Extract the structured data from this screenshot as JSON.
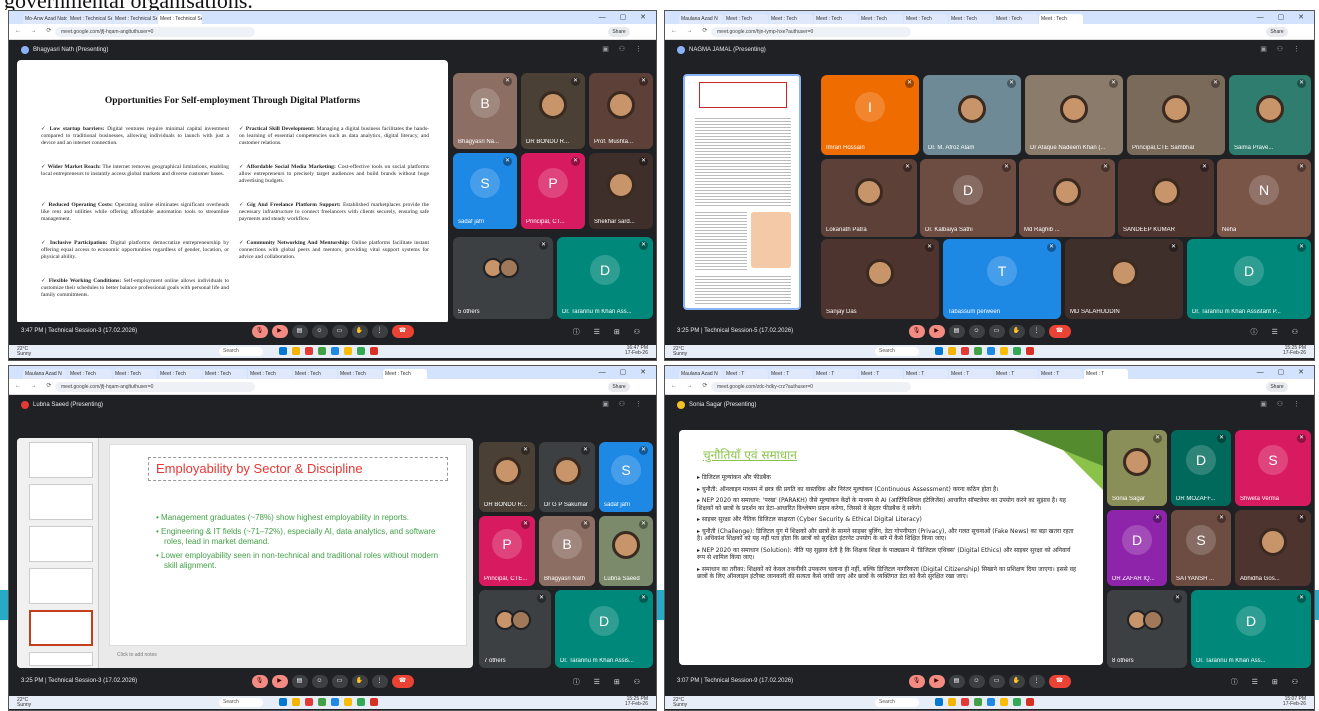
{
  "caption_fragment": "governmental organisations.",
  "tabs": {
    "q1": [
      "Mo-Anw Azad Natonal Urdu U",
      "Meet : Technical Session 3",
      "Meet : Technical Session 3",
      "Meet : Technical Session 3"
    ],
    "q2": [
      "Maulana Azad N",
      "Meet : Tech",
      "Meet : Tech",
      "Meet : Tech",
      "Meet : Tech",
      "Meet : Tech",
      "Meet : Tech",
      "Meet : Tech",
      "Meet : Tech"
    ],
    "q3": [
      "Maulana Azad N",
      "Meet : Tech",
      "Meet : Tech",
      "Meet : Tech",
      "Meet : Tech",
      "Meet : Tech",
      "Meet : Tech",
      "Meet : Tech",
      "Meet : Tech"
    ],
    "q4": [
      "Maulana Azad N",
      "Meet : T",
      "Meet : T",
      "Meet : T",
      "Meet : T",
      "Meet : T",
      "Meet : T",
      "Meet : T",
      "Meet : T",
      "Meet : T"
    ]
  },
  "urls": {
    "q1": "meet.google.com/jfj-hqam-angltuthuser=0",
    "q2": "meet.google.com/hjn-iymp-hxe?authuser=0",
    "q3": "meet.google.com/jfj-hqam-angltuthuser=0",
    "q4": "meet.google.com/zdc-hdky-crz?authuser=0"
  },
  "profile_label": "Share",
  "window_controls": "— ▢ ✕",
  "presenters": {
    "q1": "Bhagyasri Nath (Presenting)",
    "q2": "NAGMA JAMAL (Presenting)",
    "q3": "Lubna Saeed (Presenting)",
    "q4": "Sonia Sagar (Presenting)"
  },
  "meeting_info": {
    "q1": "3:47 PM  |  Technical Session-3 (17.02.2026)",
    "q2": "3:25 PM  |  Technical Session-5 (17.02.2026)",
    "q3": "3:25 PM  |  Technical Session-3 (17.02.2026)",
    "q4": "3:07 PM  |  Technical Session-9 (17.02.2026)"
  },
  "slide1": {
    "title": "Opportunities For Self-employment Through Digital Platforms",
    "left": [
      {
        "head": "Low startup barriers:",
        "text": "Digital ventures require minimal capital investment compared to traditional businesses, allowing individuals to launch with just a device and an internet connection."
      },
      {
        "head": "Wider Market Reach:",
        "text": "The internet removes geographical limitations, enabling local entrepreneurs to instantly access global markets and diverse customer bases."
      },
      {
        "head": "Reduced Operating Costs:",
        "text": "Operating online eliminates significant overheads like rent and utilities while offering affordable automation tools to streamline management."
      },
      {
        "head": "Inclusive Participation:",
        "text": "Digital platforms democratize entrepreneurship by offering equal access to economic opportunities regardless of gender, location, or physical ability."
      },
      {
        "head": "Flexible Working Conditions:",
        "text": "Self-employment online allows individuals to customize their schedules to better balance professional goals with personal life and family commitments."
      }
    ],
    "right": [
      {
        "head": "Practical Skill Development:",
        "text": "Managing a digital business facilitates the hands-on learning of essential competencies such as data analytics, digital literacy, and customer relations."
      },
      {
        "head": "Affordable Social Media Marketing:",
        "text": "Cost-effective tools on social platforms allow entrepreneurs to precisely target audiences and build brands without huge advertising budgets."
      },
      {
        "head": "Gig And Freelance Platform Support:",
        "text": "Established marketplaces provide the necessary infrastructure to connect freelancers with clients securely, ensuring safe payments and steady workflow."
      },
      {
        "head": "Community Networking And Mentorship:",
        "text": "Online platforms facilitate instant connections with global peers and mentors, providing vital support systems for advice and collaboration."
      }
    ]
  },
  "tiles_q1": [
    {
      "name": "Bhagyasri Na...",
      "initial": "B",
      "color": "#8d6e63"
    },
    {
      "name": "DR BONDU R...",
      "initial": "",
      "color": "#4a4036"
    },
    {
      "name": "Prof. Mushta...",
      "initial": "",
      "color": "#5d4037"
    },
    {
      "name": "sadaf jafri",
      "initial": "S",
      "color": "#1e88e5"
    },
    {
      "name": "Principal, CT...",
      "initial": "P",
      "color": "#d81b60"
    },
    {
      "name": "Shekhar sard...",
      "initial": "",
      "color": "#3e2f2a"
    },
    {
      "name": "5 others",
      "initial": "",
      "color": "#3c4043"
    },
    {
      "name": "Dr. Tarannu m Khan Ass...",
      "initial": "D",
      "color": "#00897b"
    }
  ],
  "tiles_q2": [
    {
      "name": "Imran Hossain",
      "initial": "I",
      "color": "#ef6c00"
    },
    {
      "name": "Dr. M. Afroz Alam",
      "initial": "",
      "color": "#6d8a96"
    },
    {
      "name": "Dr Afaque Nadeem Khan (...",
      "initial": "",
      "color": "#8a7b6a"
    },
    {
      "name": "Principal,CTE Sambhal",
      "initial": "",
      "color": "#7a6a5a"
    },
    {
      "name": "Saima Prave...",
      "initial": "",
      "color": "#2e7d6e"
    },
    {
      "name": "Lokanath Patra",
      "initial": "",
      "color": "#5d4037"
    },
    {
      "name": "Dr. Kalbaiya Sathi",
      "initial": "D",
      "color": "#6d4c41"
    },
    {
      "name": "Md Raghib ...",
      "initial": "",
      "color": "#6d4c41"
    },
    {
      "name": "SANDEEP KUMAR",
      "initial": "",
      "color": "#4e342e"
    },
    {
      "name": "Neha",
      "initial": "N",
      "color": "#795548"
    },
    {
      "name": "Sanjay Das",
      "initial": "",
      "color": "#4e342e"
    },
    {
      "name": "Tabassum perween",
      "initial": "T",
      "color": "#1e88e5"
    },
    {
      "name": "MD SALAHUDDIN",
      "initial": "",
      "color": "#3e2f2a"
    },
    {
      "name": "Dr. Tarannu m Khan Assistant P...",
      "initial": "D",
      "color": "#00897b"
    }
  ],
  "slide3": {
    "title": "Employability by Sector & Discipline",
    "bullets": [
      "Management graduates (~78%) show highest employability in reports.",
      "Engineering & IT fields (~71–72%), especially AI, data analytics, and software roles, lead in market demand.",
      "Lower employability seen in non-technical and traditional roles without modern skill alignment."
    ],
    "notes": "Click to add notes"
  },
  "tiles_q3": [
    {
      "name": "DR BONDU R...",
      "initial": "",
      "color": "#4a4036"
    },
    {
      "name": "Dr G P Sakumar",
      "initial": "",
      "color": "#3c4043"
    },
    {
      "name": "sadaf jafri",
      "initial": "S",
      "color": "#1e88e5"
    },
    {
      "name": "Principal, CTE...",
      "initial": "P",
      "color": "#d81b60"
    },
    {
      "name": "Bhagyasri Nath",
      "initial": "B",
      "color": "#8d6e63"
    },
    {
      "name": "Lubna Saeed",
      "initial": "",
      "color": "#7a8a6a"
    },
    {
      "name": "7 others",
      "initial": "",
      "color": "#3c4043"
    },
    {
      "name": "Dr. Tarannu m Khan Assis...",
      "initial": "D",
      "color": "#00897b"
    }
  ],
  "slide4": {
    "title": "चुनौतियाँ एवं समाधान",
    "lines": [
      "▸ डिजिटल मूल्यांकन और फीडबैक",
      "▸ चुनौती: ऑनलाइन माध्यम में छात्र की प्रगति का वास्तविक और निरंतर मूल्यांकन (Continuous Assessment) करना कठिन होता है।",
      "▸ NEP 2020 का समाधान: 'परख' (PARAKH) जैसे मूल्यांकन केंद्रों के माध्यम से AI (आर्टिफिशियल इंटेलिजेंस) आधारित सॉफ्टवेयर का उपयोग करने का सुझाव है। यह शिक्षकों को छात्रों के प्रदर्शन का डेटा-आधारित विश्लेषण प्रदान करेगा, जिससे वे बेहतर फीडबैक दे सकेंगे।",
      "▸ साइबर सुरक्षा और नैतिक डिजिटल साक्षरता (Cyber Security & Ethical Digital Literacy)",
      "▸ चुनौती (Challenge): डिजिटल युग में शिक्षकों और छात्रों के सामने साइबर बुलिंग, डेटा गोपनीयता (Privacy), और गलत सूचनाओं (Fake News) का बड़ा खतरा रहता है। अधिकांश शिक्षकों को यह नहीं पता होता कि छात्रों को सुरक्षित इंटरनेट उपयोग के बारे में कैसे शिक्षित किया जाए।",
      "▸ NEP 2020 का समाधान (Solution): नीति यह सुझाव देती है कि शिक्षक शिक्षा के पाठ्यक्रम में 'डिजिटल एथिक्स' (Digital Ethics) और साइबर सुरक्षा को अनिवार्य रूप से शामिल किया जाए।",
      "▸ समाधान का तरीका: शिक्षकों को केवल तकनीकी उपकरण चलाना ही नहीं, बल्कि डिजिटल नागरिकता (Digital Citizenship) सिखाने का प्रशिक्षण दिया जाएगा। इससे वह छात्रों के लिए ऑनलाइन इंटरैक्ट जानकारी की सत्यता कैसे जांची जाए और छात्रों के व्यक्तिगत डेटा को कैसे सुरक्षित रखा जाए।"
    ]
  },
  "tiles_q4": [
    {
      "name": "Sonia Sagar",
      "initial": "",
      "color": "#8a8f5a"
    },
    {
      "name": "DR MOZAFF...",
      "initial": "D",
      "color": "#00695c"
    },
    {
      "name": "Shweta Verma",
      "initial": "S",
      "color": "#d81b60"
    },
    {
      "name": "DR ZAFAR IQ...",
      "initial": "D",
      "color": "#8e24aa"
    },
    {
      "name": "SATYANSH ...",
      "initial": "S",
      "color": "#6d4c41"
    },
    {
      "name": "Abhidha Gos...",
      "initial": "",
      "color": "#4e342e"
    },
    {
      "name": "8 others",
      "initial": "",
      "color": "#3c4043"
    },
    {
      "name": "Dr. Tarannu m Khan Ass...",
      "initial": "D",
      "color": "#00897b"
    }
  ],
  "taskbar": {
    "weather_temp": "22°C",
    "weather_desc": "Sunny",
    "search": "Search",
    "lang": "ENG IN",
    "times": {
      "q1": "16:47 PM",
      "q2": "15:25 PM",
      "q3": "15:25 PM",
      "q4": "15:07 PM"
    },
    "date": "17-Feb-26"
  }
}
